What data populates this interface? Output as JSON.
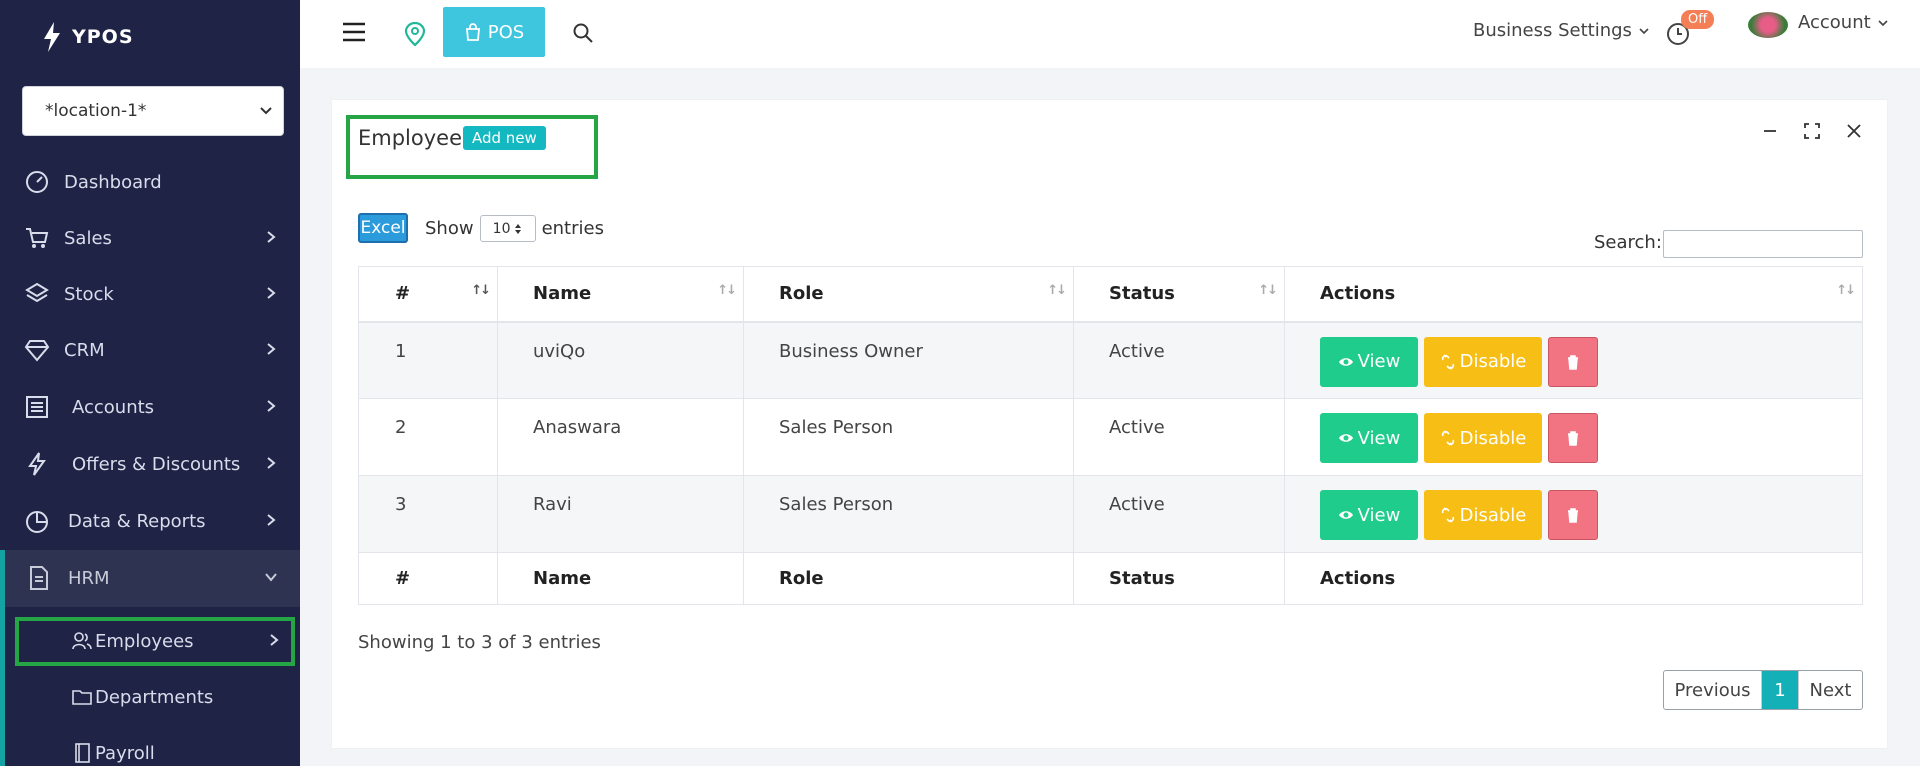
{
  "brand": {
    "name": "YPOS"
  },
  "location_select": {
    "value": "*location-1*"
  },
  "sidebar": {
    "items": [
      {
        "label": "Dashboard",
        "icon": "gauge-icon"
      },
      {
        "label": "Sales",
        "icon": "cart-icon"
      },
      {
        "label": "Stock",
        "icon": "layers-icon"
      },
      {
        "label": "CRM",
        "icon": "diamond-icon"
      },
      {
        "label": "Accounts",
        "icon": "ledger-icon"
      },
      {
        "label": "Offers & Discounts",
        "icon": "bolt-icon"
      },
      {
        "label": "Data & Reports",
        "icon": "pie-icon"
      },
      {
        "label": "HRM",
        "icon": "document-icon"
      }
    ],
    "sub_items": [
      {
        "label": "Employees",
        "icon": "users-icon"
      },
      {
        "label": "Departments",
        "icon": "folder-icon"
      },
      {
        "label": "Payroll",
        "icon": "book-icon"
      }
    ]
  },
  "topbar": {
    "pos_label": "POS",
    "business_settings": "Business Settings",
    "off_badge": "Off",
    "account": "Account"
  },
  "card": {
    "title": "Employee",
    "add_new": "Add new",
    "excel": "Excel",
    "show": "Show",
    "entries_value": "10",
    "entries": "entries",
    "search_label": "Search:",
    "search_value": ""
  },
  "table": {
    "columns": [
      "#",
      "Name",
      "Role",
      "Status",
      "Actions"
    ],
    "rows": [
      {
        "num": "1",
        "name": "uviQo",
        "role": "Business Owner",
        "status": "Active"
      },
      {
        "num": "2",
        "name": "Anaswara",
        "role": "Sales Person",
        "status": "Active"
      },
      {
        "num": "3",
        "name": "Ravi",
        "role": "Sales Person",
        "status": "Active"
      }
    ],
    "view_label": "View",
    "disable_label": "Disable"
  },
  "footer": {
    "showing": "Showing 1 to 3 of 3 entries",
    "previous": "Previous",
    "page": "1",
    "next": "Next"
  },
  "colors": {
    "sidebar_bg": "#1f2447",
    "accent": "#14b8c0",
    "view": "#1fcc8c",
    "disable": "#f7be15",
    "delete": "#f27482",
    "highlight": "#26a546"
  }
}
